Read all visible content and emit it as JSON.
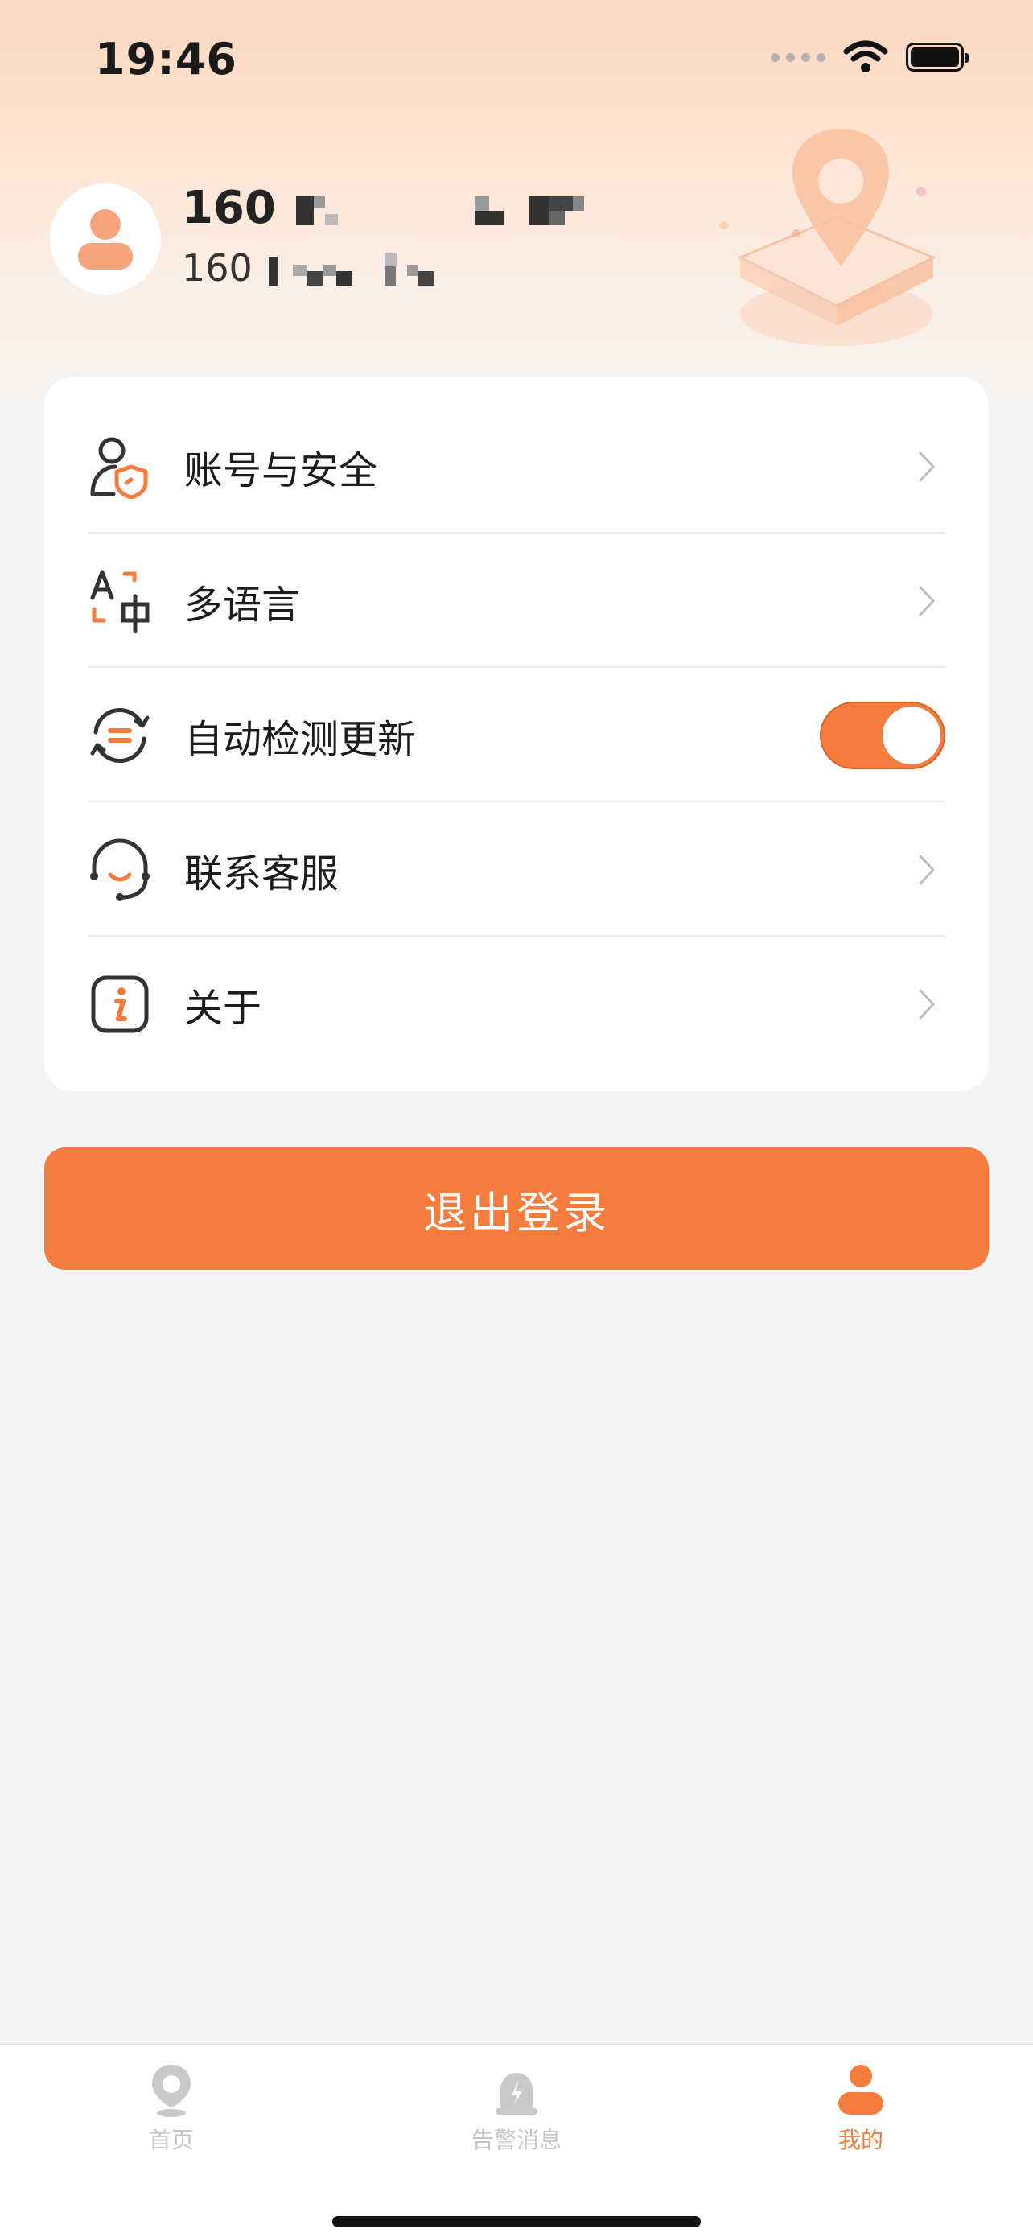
{
  "status_bar": {
    "time": "19:46"
  },
  "profile": {
    "name": "160",
    "subtitle": "160"
  },
  "menu": {
    "items": [
      {
        "label": "账号与安全",
        "icon": "user-shield-icon",
        "accessory": "chevron"
      },
      {
        "label": "多语言",
        "icon": "language-translate-icon",
        "accessory": "chevron"
      },
      {
        "label": "自动检测更新",
        "icon": "refresh-update-icon",
        "accessory": "toggle",
        "toggle_on": true
      },
      {
        "label": "联系客服",
        "icon": "headset-icon",
        "accessory": "chevron"
      },
      {
        "label": "关于",
        "icon": "info-icon",
        "accessory": "chevron"
      }
    ]
  },
  "logout_label": "退出登录",
  "tabbar": {
    "tabs": [
      {
        "label": "首页",
        "icon": "location-pin-icon",
        "active": false
      },
      {
        "label": "告警消息",
        "icon": "alarm-siren-icon",
        "active": false
      },
      {
        "label": "我的",
        "icon": "person-icon",
        "active": true
      }
    ]
  },
  "colors": {
    "accent": "#f47c3c",
    "inactive": "#c5c5c5",
    "background": "#f4f4f4"
  }
}
